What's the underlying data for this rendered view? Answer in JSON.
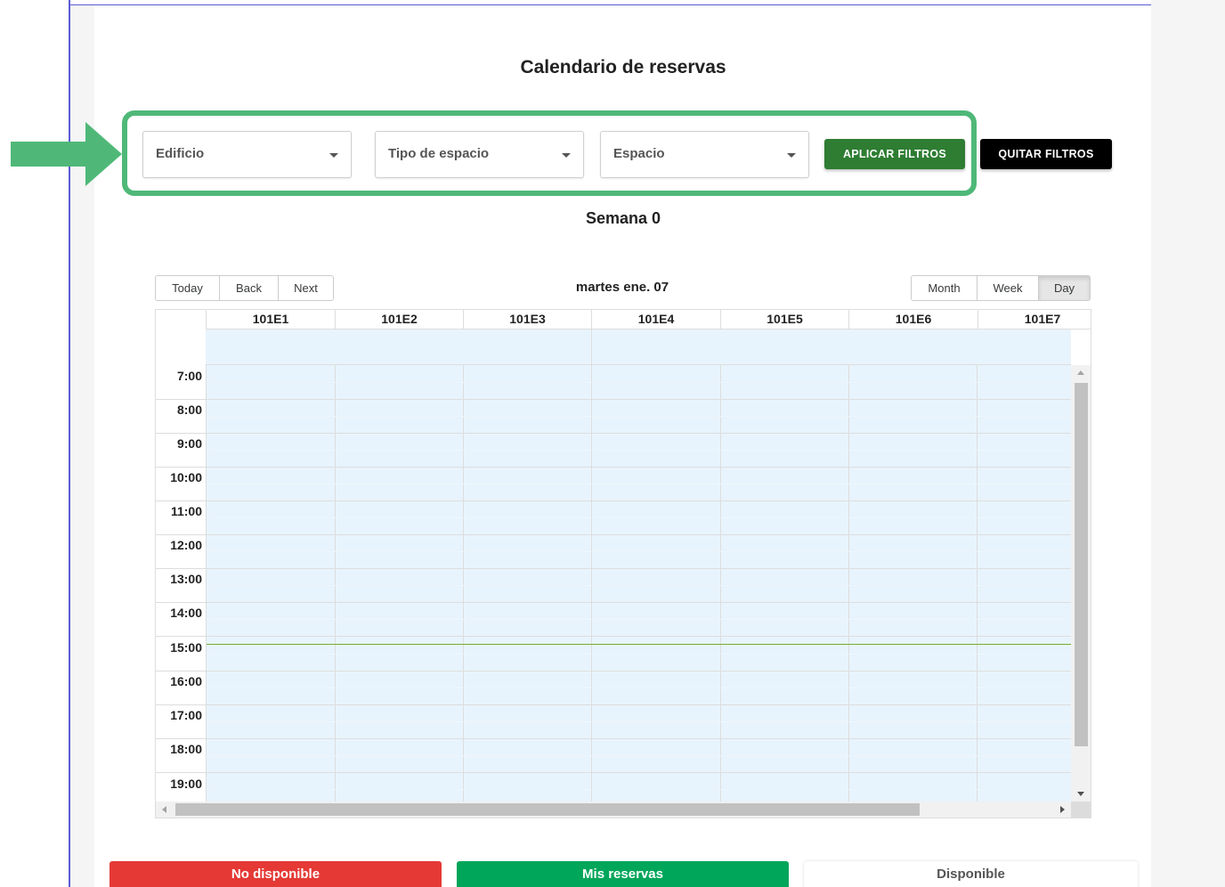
{
  "page": {
    "title": "Calendario de reservas",
    "week_label": "Semana 0"
  },
  "filters": {
    "building": {
      "placeholder": "Edificio"
    },
    "space_type": {
      "placeholder": "Tipo de espacio"
    },
    "space": {
      "placeholder": "Espacio"
    },
    "apply_label": "APLICAR FILTROS",
    "clear_label": "QUITAR FILTROS"
  },
  "calendar": {
    "nav": {
      "today": "Today",
      "back": "Back",
      "next": "Next"
    },
    "current_label": "martes ene. 07",
    "views": {
      "month": "Month",
      "week": "Week",
      "day": "Day",
      "active": "Day"
    },
    "resources": [
      "101E1",
      "101E2",
      "101E3",
      "101E4",
      "101E5",
      "101E6",
      "101E7"
    ],
    "hours": [
      "7:00",
      "8:00",
      "9:00",
      "10:00",
      "11:00",
      "12:00",
      "13:00",
      "14:00",
      "15:00",
      "16:00",
      "17:00",
      "18:00",
      "19:00"
    ]
  },
  "legend": {
    "unavailable": "No disponible",
    "mine": "Mis reservas",
    "available": "Disponible"
  },
  "colors": {
    "highlight": "#4fb878",
    "apply": "#2e7d32",
    "unavailable": "#e53935",
    "mine": "#00a65a",
    "slot_bg": "#e8f4fd",
    "now_line": "#74ad31"
  }
}
